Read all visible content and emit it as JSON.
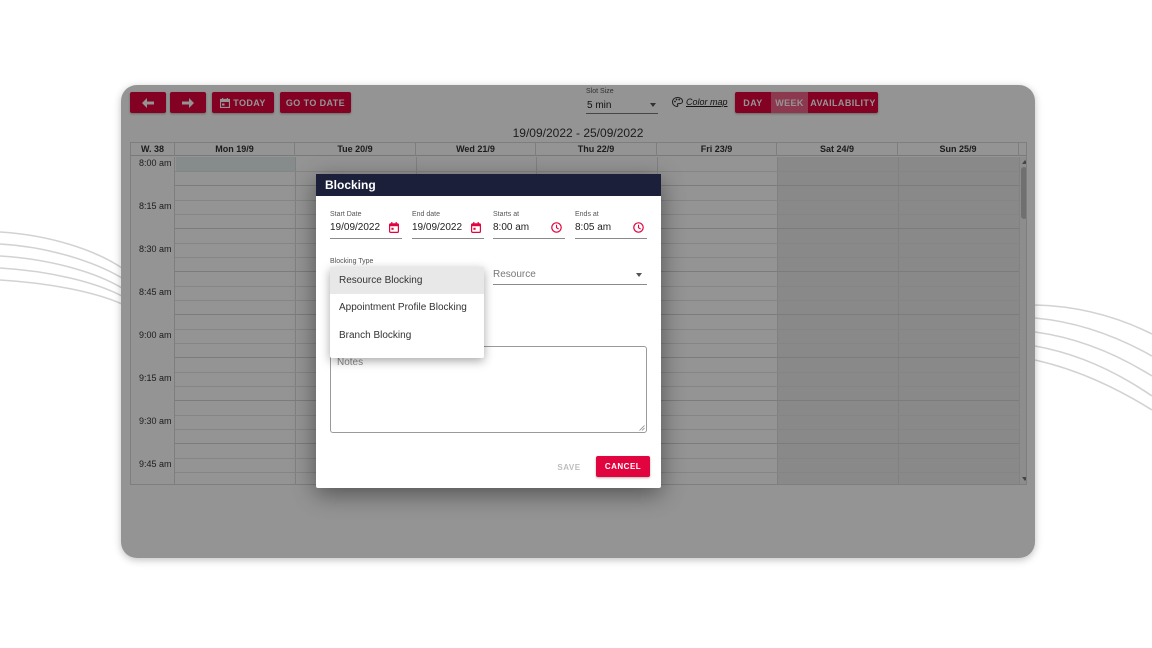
{
  "toolbar": {
    "prev_icon": "arrow-left-icon",
    "next_icon": "arrow-right-icon",
    "today_label": "TODAY",
    "today_icon": "calendar-icon",
    "go_to_date_label": "GO TO DATE",
    "slot_size": {
      "label": "Slot Size",
      "value": "5 min"
    },
    "color_map_label": "Color map",
    "color_map_icon": "palette-icon",
    "views": [
      {
        "label": "DAY",
        "active": false
      },
      {
        "label": "WEEK",
        "active": true
      },
      {
        "label": "AVAILABILITY",
        "active": false
      }
    ]
  },
  "calendar": {
    "range_label": "19/09/2022 - 25/09/2022",
    "week_label": "W. 38",
    "days": [
      "Mon 19/9",
      "Tue 20/9",
      "Wed 21/9",
      "Thu 22/9",
      "Fri 23/9",
      "Sat 24/9",
      "Sun 25/9"
    ],
    "times": [
      "8:00 am",
      "8:15 am",
      "8:30 am",
      "8:45 am",
      "9:00 am",
      "9:15 am",
      "9:30 am",
      "9:45 am"
    ]
  },
  "dialog": {
    "title": "Blocking",
    "start_date": {
      "label": "Start Date",
      "value": "19/09/2022"
    },
    "end_date": {
      "label": "End date",
      "value": "19/09/2022"
    },
    "starts_at": {
      "label": "Starts at",
      "value": "8:00 am"
    },
    "ends_at": {
      "label": "Ends at",
      "value": "8:05 am"
    },
    "blocking_type_label": "Blocking Type",
    "resource_placeholder": "Resource",
    "notes_placeholder": "Notes",
    "save_label": "SAVE",
    "cancel_label": "CANCEL",
    "blocking_type_options": [
      "Resource Blocking",
      "Appointment Profile Blocking",
      "Branch Blocking"
    ],
    "highlighted_option": "Resource Blocking"
  },
  "colors": {
    "accent": "#e2043f",
    "accent_active": "#f2638a",
    "dialog_header": "#1c1f3a",
    "overlay": "rgba(0,0,0,0.42)"
  }
}
